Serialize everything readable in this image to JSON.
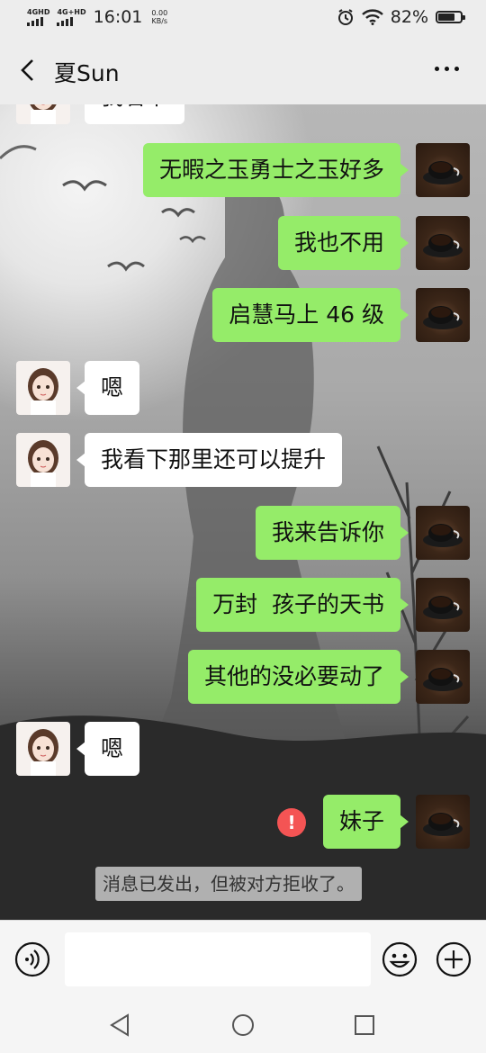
{
  "status_bar": {
    "sim1": "4GHD",
    "sim2": "4G+HD",
    "time": "16:01",
    "net_speed_value": "0.00",
    "net_speed_unit": "KB/s",
    "battery": "82%",
    "battery_level": 0.82
  },
  "header": {
    "title": "夏Sun"
  },
  "messages": [
    {
      "side": "them",
      "text": "我看下"
    },
    {
      "side": "me",
      "text": "无暇之玉勇士之玉好多"
    },
    {
      "side": "me",
      "text": "我也不用"
    },
    {
      "side": "me",
      "text": "启慧马上 46 级"
    },
    {
      "side": "them",
      "text": "嗯"
    },
    {
      "side": "them",
      "text": "我看下那里还可以提升"
    },
    {
      "side": "me",
      "text": "我来告诉你"
    },
    {
      "side": "me",
      "text": "万封  孩子的天书"
    },
    {
      "side": "me",
      "text": "其他的没必要动了"
    },
    {
      "side": "them",
      "text": "嗯"
    },
    {
      "side": "me",
      "text": "妹子",
      "failed": true,
      "error_mark": "!"
    }
  ],
  "system_notice": "消息已发出，但被对方拒收了。",
  "input": {
    "value": "",
    "placeholder": ""
  },
  "icons": {
    "back": "chevron-left-icon",
    "more": "more-dots-icon",
    "voice": "voice-icon",
    "emoji": "emoji-icon",
    "plus": "plus-icon",
    "nav_back": "nav-back-icon",
    "nav_home": "nav-home-icon",
    "nav_recent": "nav-recent-icon"
  }
}
